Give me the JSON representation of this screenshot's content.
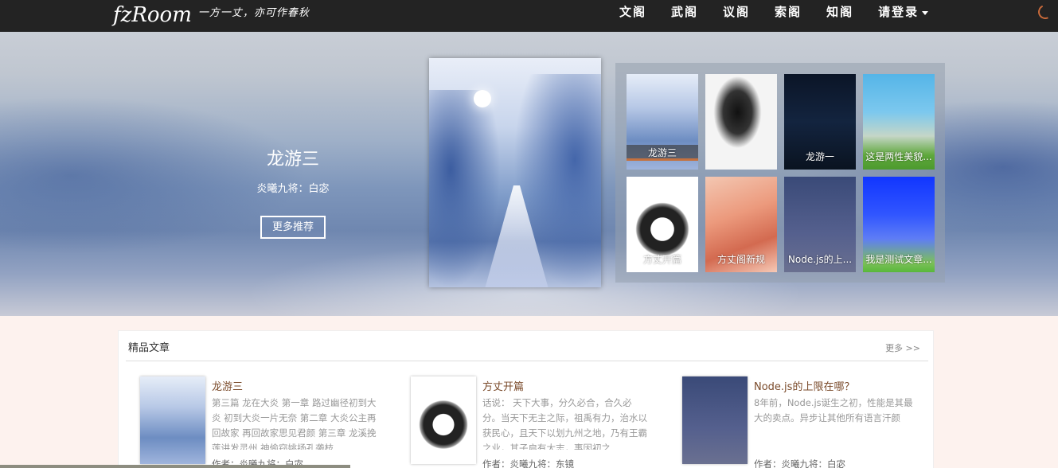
{
  "brand": {
    "logo": "fzRoom",
    "slogan": "一方一丈，亦可作春秋"
  },
  "nav": {
    "items": [
      "文阁",
      "武阁",
      "议阁",
      "索阁",
      "知阁"
    ],
    "login": "请登录"
  },
  "hero": {
    "title": "龙游三",
    "subtitle": "炎曦九将：白宓",
    "button": "更多推荐"
  },
  "thumbs": [
    {
      "label": "龙游三",
      "style": "bar"
    },
    {
      "label": ""
    },
    {
      "label": "龙游一"
    },
    {
      "label": "这是两性美貌..."
    },
    {
      "label": "方丈开篇"
    },
    {
      "label": "方丈阁新规"
    },
    {
      "label": "Node.js的上..."
    },
    {
      "label": "我是测试文章..."
    }
  ],
  "featured": {
    "title": "精品文章",
    "more": "更多 >>",
    "articles": [
      {
        "title": "龙游三",
        "excerpt": "第三篇 龙在大炎 第一章 路过幽径初到大炎 初到大炎一片无奈 第二章 大炎公主再回故家 再回故家思见君颜 第三章 龙溪挽莲讲发灵州 神偷窃姚扬孔袭枝",
        "author": "作者：炎曦九将：白宓"
      },
      {
        "title": "方丈开篇",
        "excerpt": "话说： 天下大事，分久必合，合久必分。当天下无主之际，祖禹有力，治水以获民心，且天下以划九州之地，乃有王霸之业，其子启有大志，事因初之",
        "author": "作者：炎曦九将：东镜"
      },
      {
        "title": "Node.js的上限在哪？",
        "excerpt": "8年前，Node.js诞生之初，性能是其最大的卖点。异步让其他所有语言汗颜",
        "author": "作者：炎曦九将：白宓"
      }
    ]
  },
  "colors": {
    "navbar": "#232323",
    "accent": "#c4713f",
    "page_bg": "#fdf2ee"
  }
}
